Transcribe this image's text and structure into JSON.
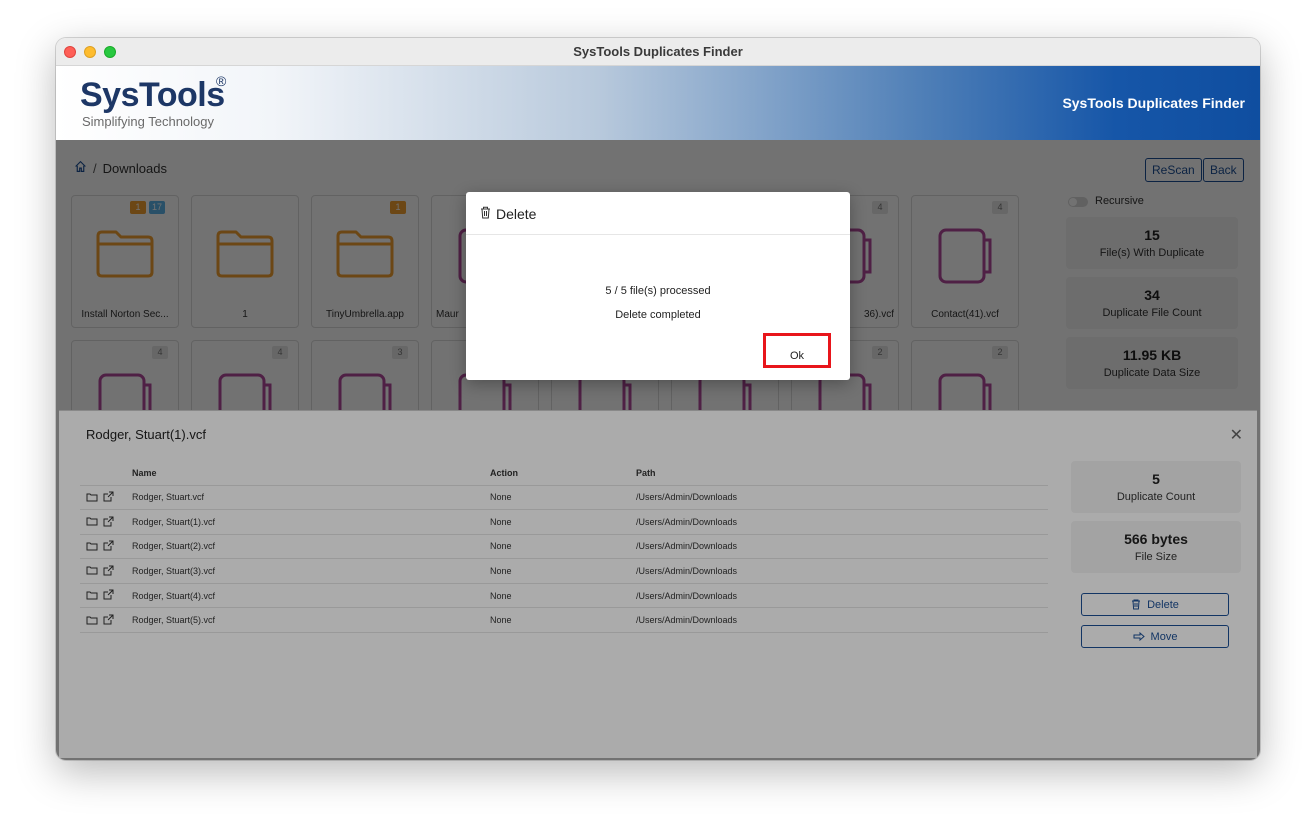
{
  "window": {
    "title": "SysTools Duplicates Finder"
  },
  "header": {
    "logo_text": "SysTools",
    "logo_reg": "®",
    "logo_tagline": "Simplifying Technology",
    "app_title": "SysTools Duplicates Finder"
  },
  "breadcrumb": {
    "current": "Downloads",
    "separator": "/"
  },
  "toolbar": {
    "rescan_label": "ReScan",
    "back_label": "Back"
  },
  "grid": {
    "row1": [
      {
        "label": "Install Norton Sec...",
        "badges": [
          "1",
          "17"
        ],
        "type": "folder"
      },
      {
        "label": "1",
        "badges": [],
        "type": "folder"
      },
      {
        "label": "TinyUmbrella.app",
        "badges": [
          "1"
        ],
        "type": "folder"
      },
      {
        "label": "Maur",
        "badges": [],
        "type": "vcf"
      },
      {
        "label": "36).vcf",
        "badges": [
          "4"
        ],
        "type": "vcf"
      },
      {
        "label": "Contact(41).vcf",
        "badges": [
          "4"
        ],
        "type": "vcf"
      }
    ],
    "row2_badges": [
      "4",
      "4",
      "3",
      "2",
      "2"
    ]
  },
  "sidebar": {
    "recursive_label": "Recursive",
    "stats": [
      {
        "value": "15",
        "caption": "File(s) With Duplicate"
      },
      {
        "value": "34",
        "caption": "Duplicate File Count"
      },
      {
        "value": "11.95 KB",
        "caption": "Duplicate Data Size"
      }
    ]
  },
  "panel": {
    "title": "Rodger, Stuart(1).vcf",
    "close": "✕",
    "columns": {
      "name": "Name",
      "action": "Action",
      "path": "Path"
    },
    "rows": [
      {
        "name": "Rodger, Stuart.vcf",
        "action": "None",
        "path": "/Users/Admin/Downloads"
      },
      {
        "name": "Rodger, Stuart(1).vcf",
        "action": "None",
        "path": "/Users/Admin/Downloads"
      },
      {
        "name": "Rodger, Stuart(2).vcf",
        "action": "None",
        "path": "/Users/Admin/Downloads"
      },
      {
        "name": "Rodger, Stuart(3).vcf",
        "action": "None",
        "path": "/Users/Admin/Downloads"
      },
      {
        "name": "Rodger, Stuart(4).vcf",
        "action": "None",
        "path": "/Users/Admin/Downloads"
      },
      {
        "name": "Rodger, Stuart(5).vcf",
        "action": "None",
        "path": "/Users/Admin/Downloads"
      }
    ],
    "stats": [
      {
        "value": "5",
        "caption": "Duplicate Count"
      },
      {
        "value": "566 bytes",
        "caption": "File Size"
      }
    ],
    "delete_label": "Delete",
    "move_label": "Move"
  },
  "modal": {
    "title": "Delete",
    "progress": "5 / 5 file(s) processed",
    "status": "Delete completed",
    "ok_label": "Ok"
  },
  "colors": {
    "accent": "#1c4f96",
    "highlight": "#e8151b",
    "folder": "#f0a030",
    "vcf": "#b04a9a"
  }
}
